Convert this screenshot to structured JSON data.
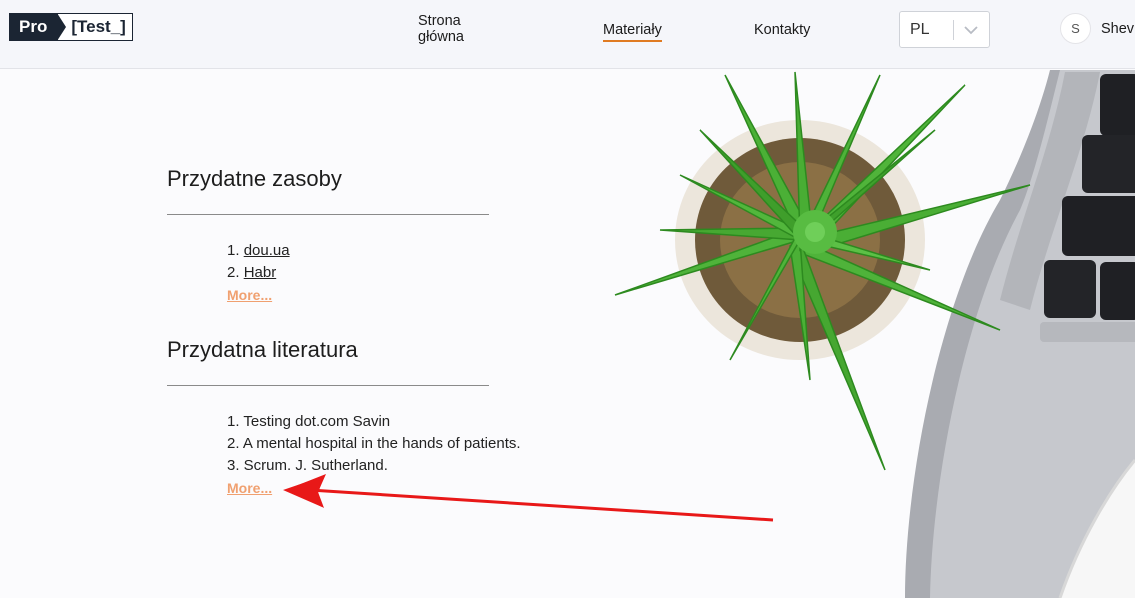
{
  "header": {
    "logo": {
      "part1": "Pro",
      "part2": "[Test_]"
    },
    "nav": {
      "home": "Strona główna",
      "materials": "Materiały",
      "contacts": "Kontakty"
    },
    "language": {
      "selected": "PL"
    },
    "user": {
      "avatar_letter": "S",
      "name": "Shev"
    }
  },
  "sections": {
    "resources": {
      "title": "Przydatne zasoby",
      "items": [
        {
          "num": "1.",
          "text": "dou.ua"
        },
        {
          "num": "2.",
          "text": "Habr"
        }
      ],
      "more": "More..."
    },
    "literature": {
      "title": "Przydatna literatura",
      "items": [
        "1. Testing dot.com Savin",
        "2. A mental hospital in the hands of patients.",
        "3. Scrum. J. Sutherland."
      ],
      "more": "More..."
    }
  },
  "colors": {
    "accent": "#e07b22",
    "more_link": "#f0a070",
    "annotation_arrow": "#e81818",
    "logo_dark": "#1b2533"
  }
}
